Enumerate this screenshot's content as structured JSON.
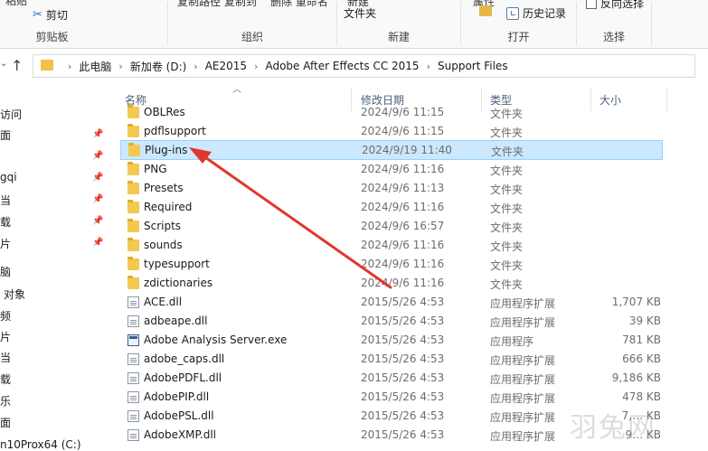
{
  "ribbon": {
    "clipboard": {
      "top_text": "粘贴",
      "cut_label": "剪切",
      "group_label": "剪贴板",
      "extra_top": "复制路径  复制到",
      "extra_top2": "删除   重命名"
    },
    "organize": {
      "group_label": "组织"
    },
    "new": {
      "top_text": "新建",
      "folder_label": "文件夹",
      "group_label": "新建"
    },
    "open": {
      "top_text": "属性",
      "history_label": "历史记录",
      "group_label": "打开"
    },
    "select": {
      "invert_label": "反向选择",
      "group_label": "选择"
    }
  },
  "address": {
    "crumbs": [
      "此电脑",
      "新加卷 (D:)",
      "AE2015",
      "Adobe After Effects CC 2015",
      "Support Files"
    ]
  },
  "navpane": {
    "items": [
      {
        "label": "访问",
        "pinned": false
      },
      {
        "label": "面",
        "pinned": true
      },
      {
        "label": "",
        "pinned": true
      },
      {
        "label": "gqi",
        "pinned": true
      },
      {
        "label": "当",
        "pinned": true
      },
      {
        "label": "载",
        "pinned": true
      },
      {
        "label": "片",
        "pinned": true
      },
      {
        "label": "脑",
        "pinned": false
      },
      {
        "label": "对象",
        "pinned": false
      },
      {
        "label": "频",
        "pinned": false
      },
      {
        "label": "片",
        "pinned": false
      },
      {
        "label": "当",
        "pinned": false
      },
      {
        "label": "载",
        "pinned": false
      },
      {
        "label": "乐",
        "pinned": false
      },
      {
        "label": "面",
        "pinned": false
      },
      {
        "label": "n10Prox64 (C:)",
        "pinned": false
      }
    ]
  },
  "columns": {
    "name": "名称",
    "date": "修改日期",
    "type": "类型",
    "size": "大小"
  },
  "files": [
    {
      "name": "OBLRes",
      "date": "2024/9/6 11:15",
      "type": "文件夹",
      "size": "",
      "icon": "folder-icon"
    },
    {
      "name": "pdflsupport",
      "date": "2024/9/6 11:15",
      "type": "文件夹",
      "size": "",
      "icon": "folder-icon"
    },
    {
      "name": "Plug-ins",
      "date": "2024/9/19 11:40",
      "type": "文件夹",
      "size": "",
      "icon": "folder-icon",
      "selected": true
    },
    {
      "name": "PNG",
      "date": "2024/9/6 11:16",
      "type": "文件夹",
      "size": "",
      "icon": "folder-icon"
    },
    {
      "name": "Presets",
      "date": "2024/9/6 11:13",
      "type": "文件夹",
      "size": "",
      "icon": "folder-icon"
    },
    {
      "name": "Required",
      "date": "2024/9/6 11:16",
      "type": "文件夹",
      "size": "",
      "icon": "folder-icon"
    },
    {
      "name": "Scripts",
      "date": "2024/9/6 16:57",
      "type": "文件夹",
      "size": "",
      "icon": "folder-icon"
    },
    {
      "name": "sounds",
      "date": "2024/9/6 11:16",
      "type": "文件夹",
      "size": "",
      "icon": "folder-icon"
    },
    {
      "name": "typesupport",
      "date": "2024/9/6 11:16",
      "type": "文件夹",
      "size": "",
      "icon": "folder-icon"
    },
    {
      "name": "zdictionaries",
      "date": "2024/9/6 11:16",
      "type": "文件夹",
      "size": "",
      "icon": "folder-icon"
    },
    {
      "name": "ACE.dll",
      "date": "2015/5/26 4:53",
      "type": "应用程序扩展",
      "size": "1,707 KB",
      "icon": "dll-file-icon"
    },
    {
      "name": "adbeape.dll",
      "date": "2015/5/26 4:53",
      "type": "应用程序扩展",
      "size": "39 KB",
      "icon": "dll-file-icon"
    },
    {
      "name": "Adobe Analysis Server.exe",
      "date": "2015/5/26 4:53",
      "type": "应用程序",
      "size": "781 KB",
      "icon": "exe-file-icon"
    },
    {
      "name": "adobe_caps.dll",
      "date": "2015/5/26 4:53",
      "type": "应用程序扩展",
      "size": "666 KB",
      "icon": "dll-file-icon"
    },
    {
      "name": "AdobePDFL.dll",
      "date": "2015/5/26 4:53",
      "type": "应用程序扩展",
      "size": "9,186 KB",
      "icon": "dll-file-icon"
    },
    {
      "name": "AdobePIP.dll",
      "date": "2015/5/26 4:53",
      "type": "应用程序扩展",
      "size": "478 KB",
      "icon": "dll-file-icon"
    },
    {
      "name": "AdobePSL.dll",
      "date": "2015/5/26 4:53",
      "type": "应用程序扩展",
      "size": "7,… KB",
      "icon": "dll-file-icon"
    },
    {
      "name": "AdobeXMP.dll",
      "date": "2015/5/26 4:53",
      "type": "应用程序扩展",
      "size": "9… KB",
      "icon": "dll-file-icon"
    }
  ],
  "watermark": "羽兔网",
  "colors": {
    "selection_bg": "#cce8ff",
    "selection_border": "#99d1ff",
    "annotation_arrow": "#e0362c",
    "folder": "#f3c853"
  }
}
